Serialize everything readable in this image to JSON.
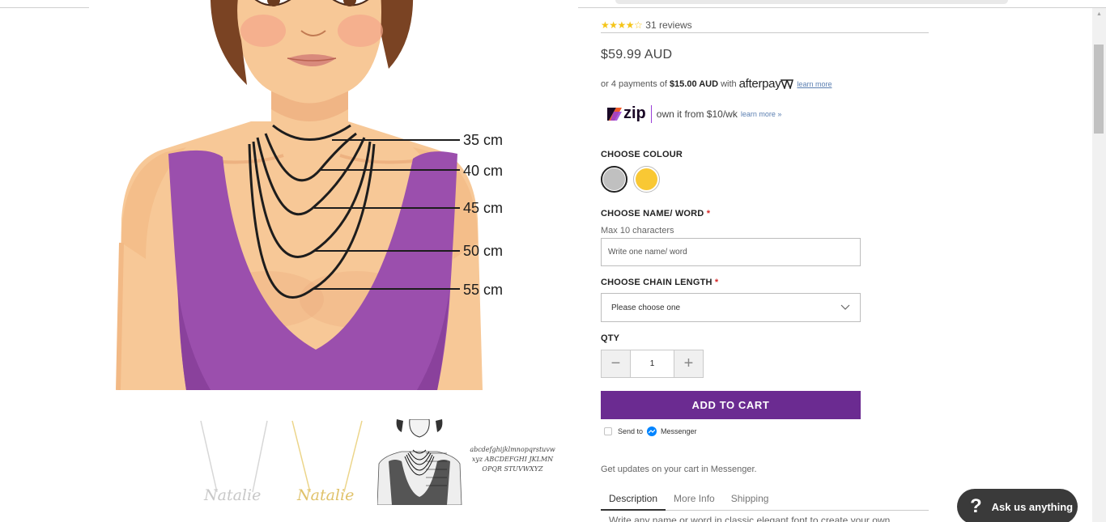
{
  "rating": {
    "stars": "★★★★☆",
    "reviews_label": "31 reviews"
  },
  "price": "$59.99 AUD",
  "afterpay": {
    "prefix": "or 4 payments of",
    "amount": "$15.00 AUD",
    "with": "with",
    "brand": "afterpay",
    "learn_more": "learn more"
  },
  "zip": {
    "brand": "zip",
    "text": "own it from $10/wk",
    "learn_more": "learn more »"
  },
  "colour": {
    "label": "CHOOSE COLOUR",
    "options": [
      {
        "name": "silver",
        "hex": "#c0c0c0",
        "selected": true
      },
      {
        "name": "gold",
        "hex": "#f9c834",
        "selected": false
      }
    ]
  },
  "name_word": {
    "label": "CHOOSE NAME/ WORD",
    "required_mark": "*",
    "hint": "Max 10 characters",
    "placeholder": "Write one name/ word"
  },
  "chain_length": {
    "label": "CHOOSE CHAIN LENGTH",
    "required_mark": "*",
    "selected": "Please choose one"
  },
  "qty": {
    "label": "QTY",
    "value": "1",
    "minus": "−",
    "plus": "+"
  },
  "add_to_cart": "ADD TO CART",
  "messenger": {
    "send_to": "Send to",
    "brand": "Messenger"
  },
  "updates_text": "Get updates on your cart in Messenger.",
  "tabs": [
    "Description",
    "More Info",
    "Shipping"
  ],
  "description_preview": "Write any name or word in classic elegant font to create your own",
  "image_labels": [
    "35 cm",
    "40 cm",
    "45 cm",
    "50 cm",
    "55 cm"
  ],
  "thumbnails": [
    {
      "name": "silver-necklace-thumb",
      "script_text": "Natalie"
    },
    {
      "name": "gold-necklace-thumb",
      "script_text": "Natalie"
    },
    {
      "name": "length-chart-thumb"
    },
    {
      "name": "font-sample-thumb",
      "script_text": "abcdefghijklmnopqrstuvwxyz ABCDEFGHI JKLMNOPQR STUVWXYZ"
    }
  ],
  "chat": {
    "icon": "?",
    "label": "Ask us anything"
  },
  "colors": {
    "accent": "#6b2b91",
    "star": "#f5c518",
    "dress": "#9b4fad",
    "skin": "#f9cc9a"
  }
}
